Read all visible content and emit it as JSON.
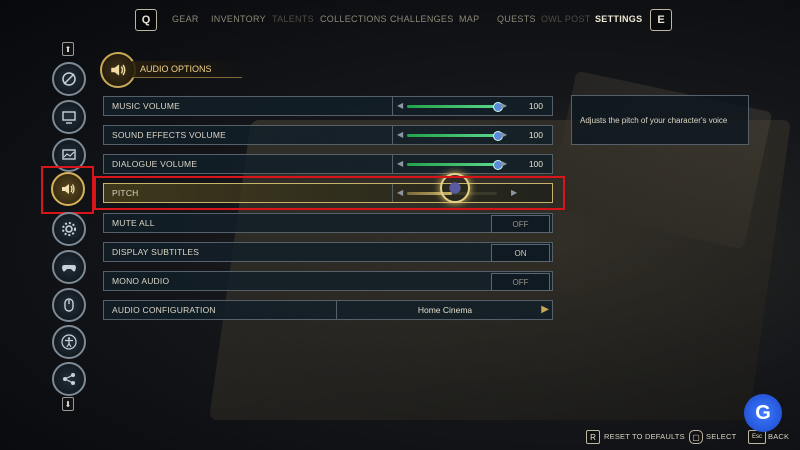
{
  "nav": {
    "left_key": "Q",
    "right_key": "E",
    "items": [
      "GEAR",
      "INVENTORY",
      "TALENTS",
      "COLLECTIONS",
      "CHALLENGES",
      "MAP",
      "QUESTS",
      "OWL POST",
      "SETTINGS"
    ],
    "active": "SETTINGS"
  },
  "section": {
    "title": "AUDIO OPTIONS"
  },
  "settings": {
    "music_volume": {
      "label": "MUSIC VOLUME",
      "value": "100",
      "level": 1.0
    },
    "sfx_volume": {
      "label": "SOUND EFFECTS VOLUME",
      "value": "100",
      "level": 1.0
    },
    "dialogue_volume": {
      "label": "DIALOGUE VOLUME",
      "value": "100",
      "level": 1.0
    },
    "pitch": {
      "label": "PITCH",
      "level": 0.5
    },
    "mute_all": {
      "label": "MUTE ALL",
      "value": "OFF"
    },
    "display_subtitles": {
      "label": "DISPLAY SUBTITLES",
      "value": "ON"
    },
    "mono_audio": {
      "label": "MONO AUDIO",
      "value": "OFF"
    },
    "audio_configuration": {
      "label": "AUDIO CONFIGURATION",
      "value": "Home Cinema"
    }
  },
  "info_text": "Adjusts the pitch of your character's voice",
  "footer": {
    "reset_key": "R",
    "reset_label": "RESET TO DEFAULTS",
    "select_label": "SELECT",
    "back_key": "Esc",
    "back_label": "BACK"
  },
  "sidebar_icons": [
    "disc-icon",
    "monitor-icon",
    "graphics-icon",
    "speaker-icon",
    "gear-icon",
    "gamepad-icon",
    "mouse-icon",
    "accessibility-icon",
    "network-icon"
  ],
  "colors": {
    "accent_gold": "#c9a957",
    "slider_green": "#21a34a",
    "highlight_red": "#d9141a"
  }
}
